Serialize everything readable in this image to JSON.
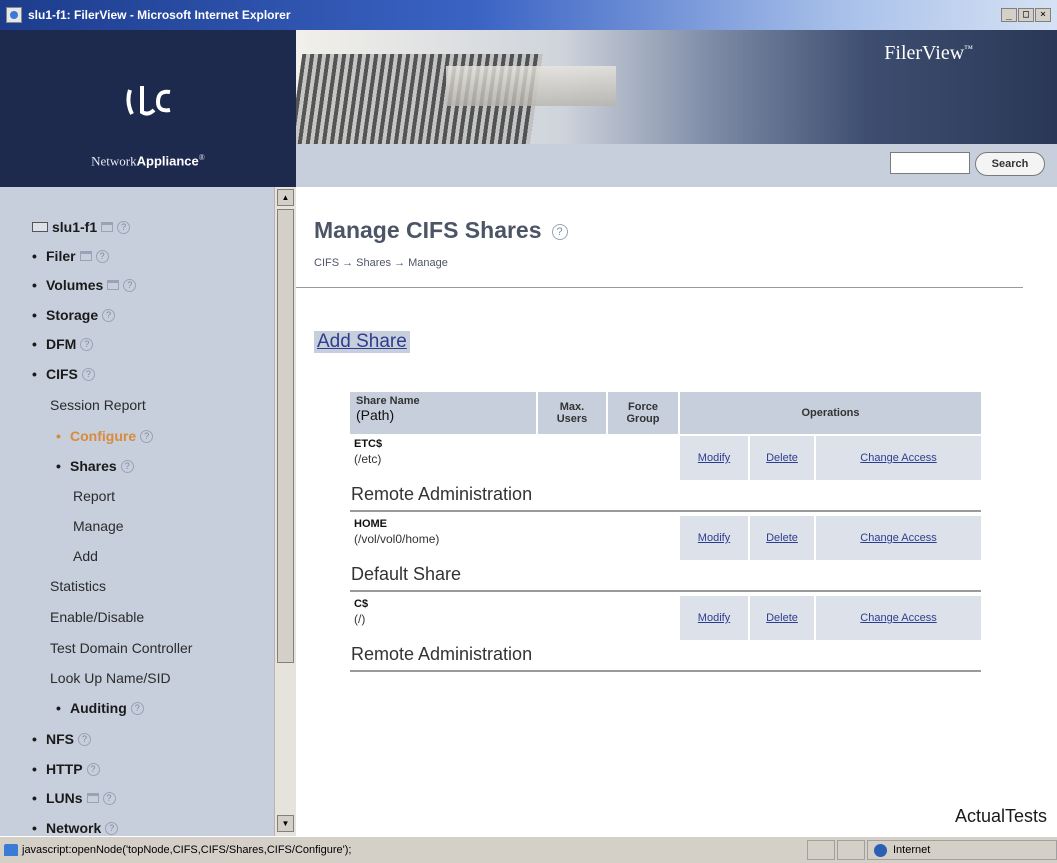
{
  "window": {
    "title": "slu1-f1: FilerView - Microsoft Internet Explorer",
    "controls": [
      "_",
      "□",
      "×"
    ]
  },
  "header": {
    "brand_name_prefix": "Network",
    "brand_name_bold": "Appliance",
    "brand_reg": "®",
    "product": "FilerView",
    "product_tm": "™",
    "search_button": "Search",
    "search_value": ""
  },
  "sidebar": {
    "filer_name": "slu1-f1",
    "items": [
      {
        "label": "Filer",
        "bullet": "•"
      },
      {
        "label": "Volumes",
        "bullet": "•"
      },
      {
        "label": "Storage",
        "bullet": "•"
      },
      {
        "label": "DFM",
        "bullet": "•"
      },
      {
        "label": "CIFS",
        "bullet": "•"
      },
      {
        "label": "Session Report"
      },
      {
        "label": "Configure",
        "bullet": "•"
      },
      {
        "label": "Shares",
        "bullet": "•"
      },
      {
        "label": "Report"
      },
      {
        "label": "Manage"
      },
      {
        "label": "Add"
      },
      {
        "label": "Statistics"
      },
      {
        "label": "Enable/Disable"
      },
      {
        "label": "Test Domain Controller"
      },
      {
        "label": "Look Up Name/SID"
      },
      {
        "label": "Auditing",
        "bullet": "•"
      },
      {
        "label": "NFS",
        "bullet": "•"
      },
      {
        "label": "HTTP",
        "bullet": "•"
      },
      {
        "label": "LUNs",
        "bullet": "•"
      },
      {
        "label": "Network",
        "bullet": "•"
      }
    ],
    "help_glyph": "?"
  },
  "main": {
    "title": "Manage CIFS Shares",
    "breadcrumb": "CIFS → Shares → Manage",
    "add_share": "Add Share",
    "table": {
      "headers": {
        "share_name": "Share Name",
        "path": "(Path)",
        "max_users": "Max. Users",
        "force_group": "Force Group",
        "operations": "Operations"
      },
      "rows": [
        {
          "name": "ETC$",
          "path": "(/etc)",
          "comment": "Remote Administration"
        },
        {
          "name": "HOME",
          "path": "(/vol/vol0/home)",
          "comment": "Default Share"
        },
        {
          "name": "C$",
          "path": "(/)",
          "comment": "Remote Administration"
        }
      ],
      "ops": {
        "modify": "Modify",
        "delete": "Delete",
        "change_access": "Change Access"
      }
    }
  },
  "statusbar": {
    "text": "javascript:openNode('topNode,CIFS,CIFS/Shares,CIFS/Configure');",
    "zone": "Internet"
  },
  "watermark": "ActualTests"
}
